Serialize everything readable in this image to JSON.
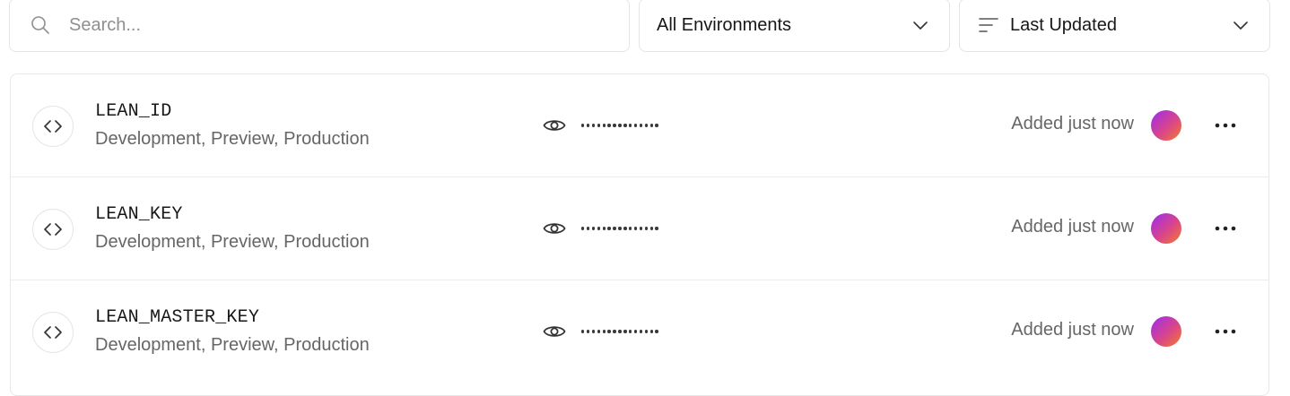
{
  "search": {
    "placeholder": "Search..."
  },
  "filters": {
    "environment_label": "All Environments",
    "sort_label": "Last Updated"
  },
  "colors": {
    "avatar_gradient_start": "#9b2cf0",
    "avatar_gradient_end": "#f57c2a"
  },
  "variables": [
    {
      "name": "LEAN_ID",
      "environments": "Development, Preview, Production",
      "masked_value": "•••••••••••••••",
      "added": "Added just now"
    },
    {
      "name": "LEAN_KEY",
      "environments": "Development, Preview, Production",
      "masked_value": "•••••••••••••••",
      "added": "Added just now"
    },
    {
      "name": "LEAN_MASTER_KEY",
      "environments": "Development, Preview, Production",
      "masked_value": "•••••••••••••••",
      "added": "Added just now"
    }
  ],
  "icons": {
    "search": "search-icon",
    "chevron": "chevron-down-icon",
    "sort": "sort-lines-icon",
    "code": "code-brackets-icon",
    "eye": "eye-icon",
    "more": "more-horizontal-icon"
  }
}
